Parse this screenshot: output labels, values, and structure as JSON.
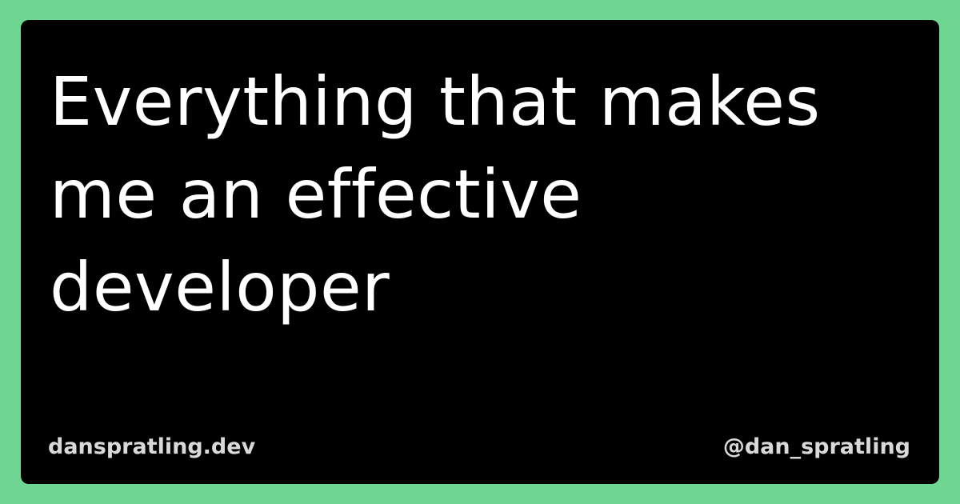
{
  "card": {
    "title": "Everything that makes me an effective developer",
    "site": "danspratling.dev",
    "handle": "@dan_spratling"
  },
  "colors": {
    "background": "#6fd691",
    "card": "#000000",
    "title_text": "#ffffff",
    "footer_text": "#d9d9d9"
  }
}
